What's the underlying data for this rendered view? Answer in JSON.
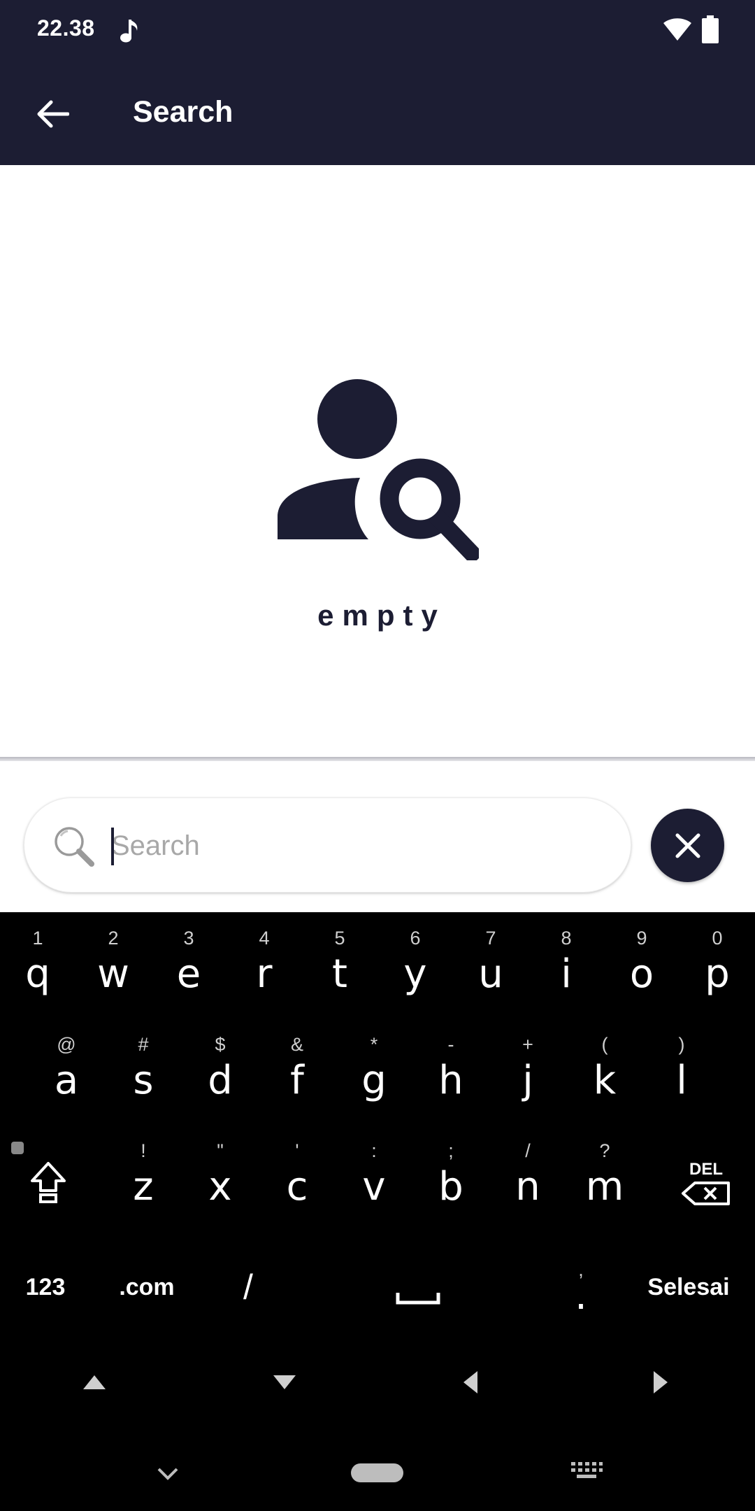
{
  "status_bar": {
    "time": "22.38",
    "icons": [
      "music-note-icon",
      "wifi-icon",
      "battery-icon"
    ]
  },
  "app_bar": {
    "title": "Search",
    "back_icon": "arrow-left-icon"
  },
  "empty_state": {
    "icon": "person-search-icon",
    "text": "empty"
  },
  "search": {
    "placeholder": "Search",
    "value": "",
    "icon": "magnifier-icon",
    "clear_icon": "close-icon"
  },
  "keyboard": {
    "row1": [
      {
        "hint": "1",
        "key": "q"
      },
      {
        "hint": "2",
        "key": "w"
      },
      {
        "hint": "3",
        "key": "e"
      },
      {
        "hint": "4",
        "key": "r"
      },
      {
        "hint": "5",
        "key": "t"
      },
      {
        "hint": "6",
        "key": "y"
      },
      {
        "hint": "7",
        "key": "u"
      },
      {
        "hint": "8",
        "key": "i"
      },
      {
        "hint": "9",
        "key": "o"
      },
      {
        "hint": "0",
        "key": "p"
      }
    ],
    "row2": [
      {
        "hint": "@",
        "key": "a"
      },
      {
        "hint": "#",
        "key": "s"
      },
      {
        "hint": "$",
        "key": "d"
      },
      {
        "hint": "&",
        "key": "f"
      },
      {
        "hint": "*",
        "key": "g"
      },
      {
        "hint": "-",
        "key": "h"
      },
      {
        "hint": "+",
        "key": "j"
      },
      {
        "hint": "(",
        "key": "k"
      },
      {
        "hint": ")",
        "key": "l"
      }
    ],
    "row3": [
      {
        "hint": "!",
        "key": "z"
      },
      {
        "hint": "\"",
        "key": "x"
      },
      {
        "hint": "'",
        "key": "c"
      },
      {
        "hint": ":",
        "key": "v"
      },
      {
        "hint": ";",
        "key": "b"
      },
      {
        "hint": "/",
        "key": "n"
      },
      {
        "hint": "?",
        "key": "m"
      }
    ],
    "shift_icon": "shift-icon",
    "delete_label": "DEL",
    "bottom": {
      "numbers": "123",
      "dotcom": ".com",
      "slash": "/",
      "period_hint": ",",
      "period": ".",
      "done": "Selesai"
    },
    "nav_icons": [
      "arrow-up-icon",
      "arrow-down-icon",
      "arrow-left-icon",
      "arrow-right-icon"
    ]
  },
  "colors": {
    "primary": "#1c1d33",
    "keyboard_bg": "#000000",
    "placeholder": "#a8a8a8"
  }
}
